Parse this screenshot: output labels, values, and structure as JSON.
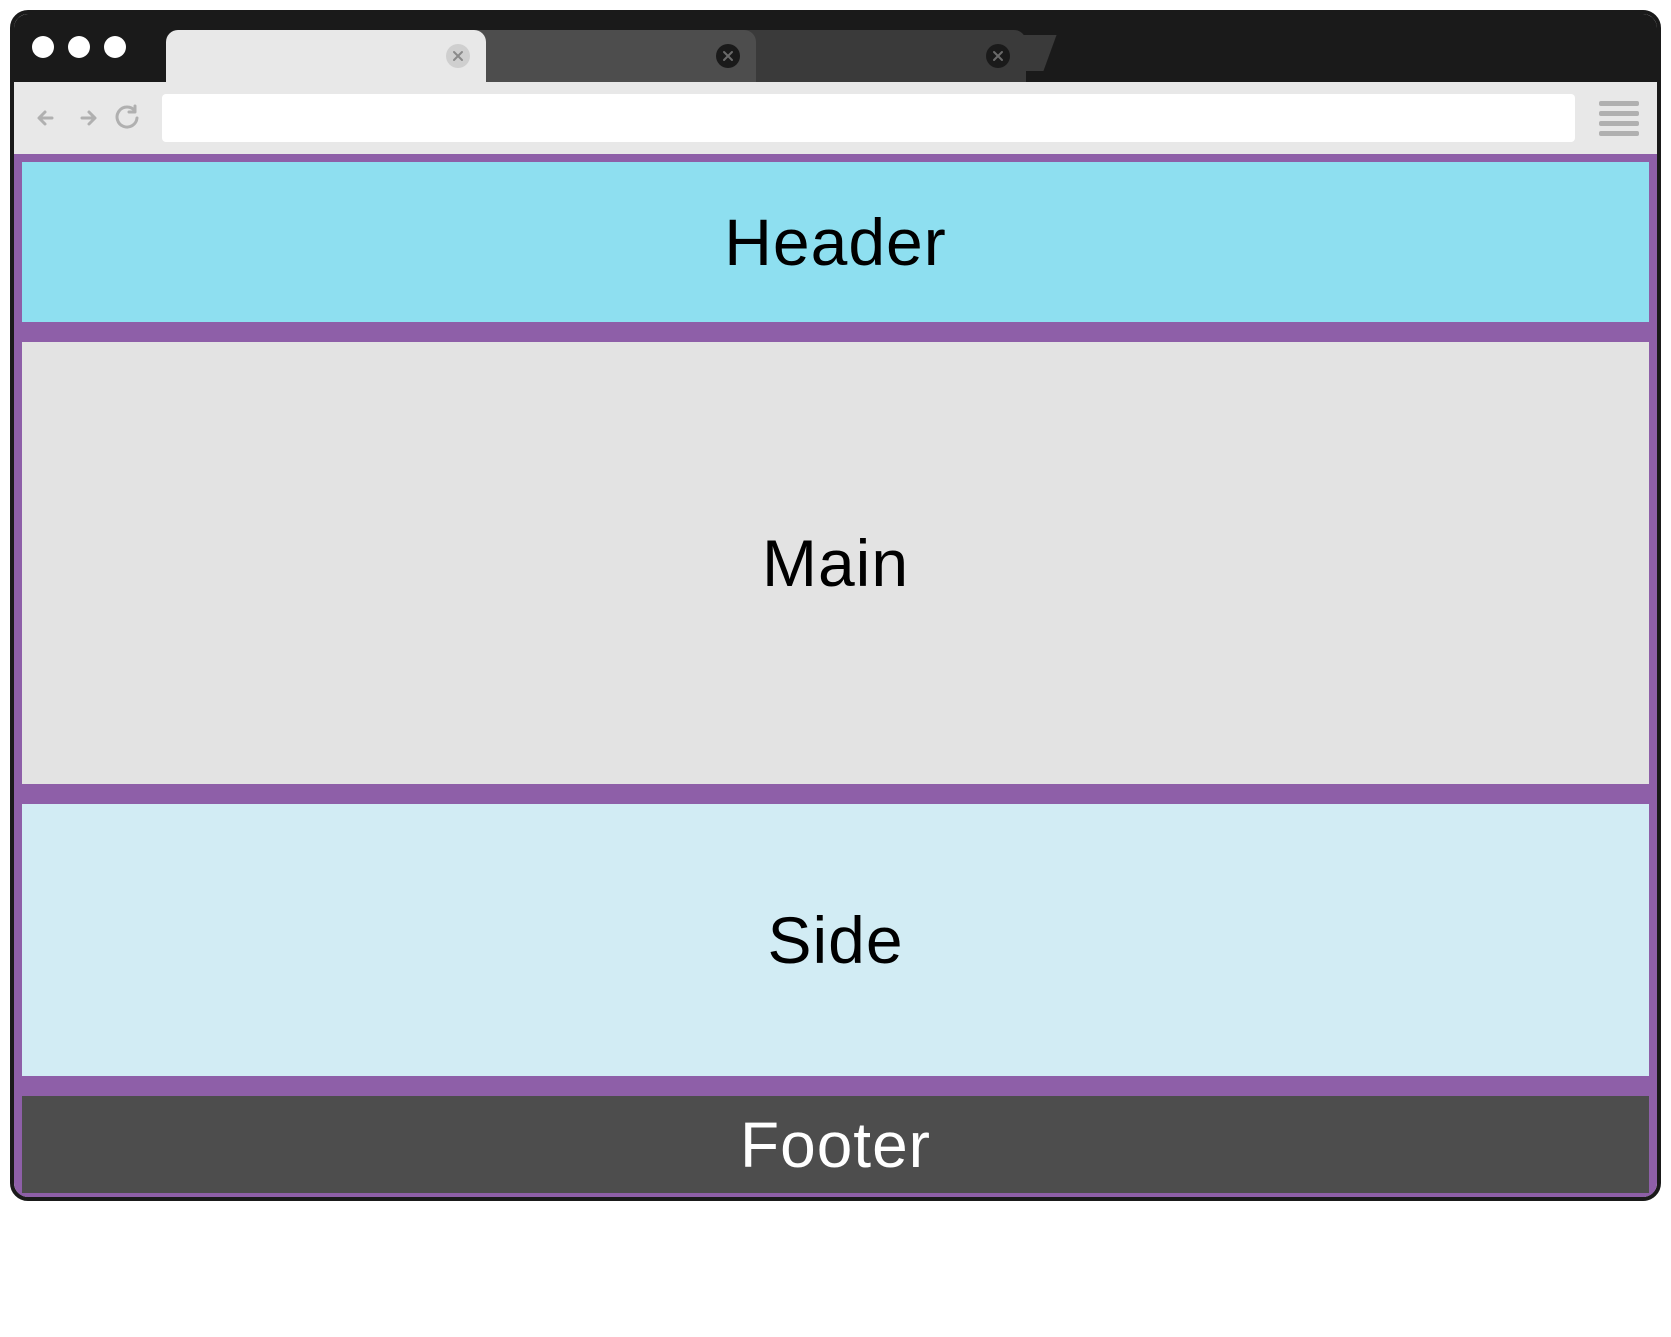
{
  "layout": {
    "header": "Header",
    "main": "Main",
    "side": "Side",
    "footer": "Footer"
  },
  "colors": {
    "frame_border": "#8e5fa8",
    "header_bg": "#8edff0",
    "main_bg": "#e3e3e3",
    "side_bg": "#d2ecf4",
    "footer_bg": "#4d4d4d",
    "footer_text": "#ffffff"
  }
}
